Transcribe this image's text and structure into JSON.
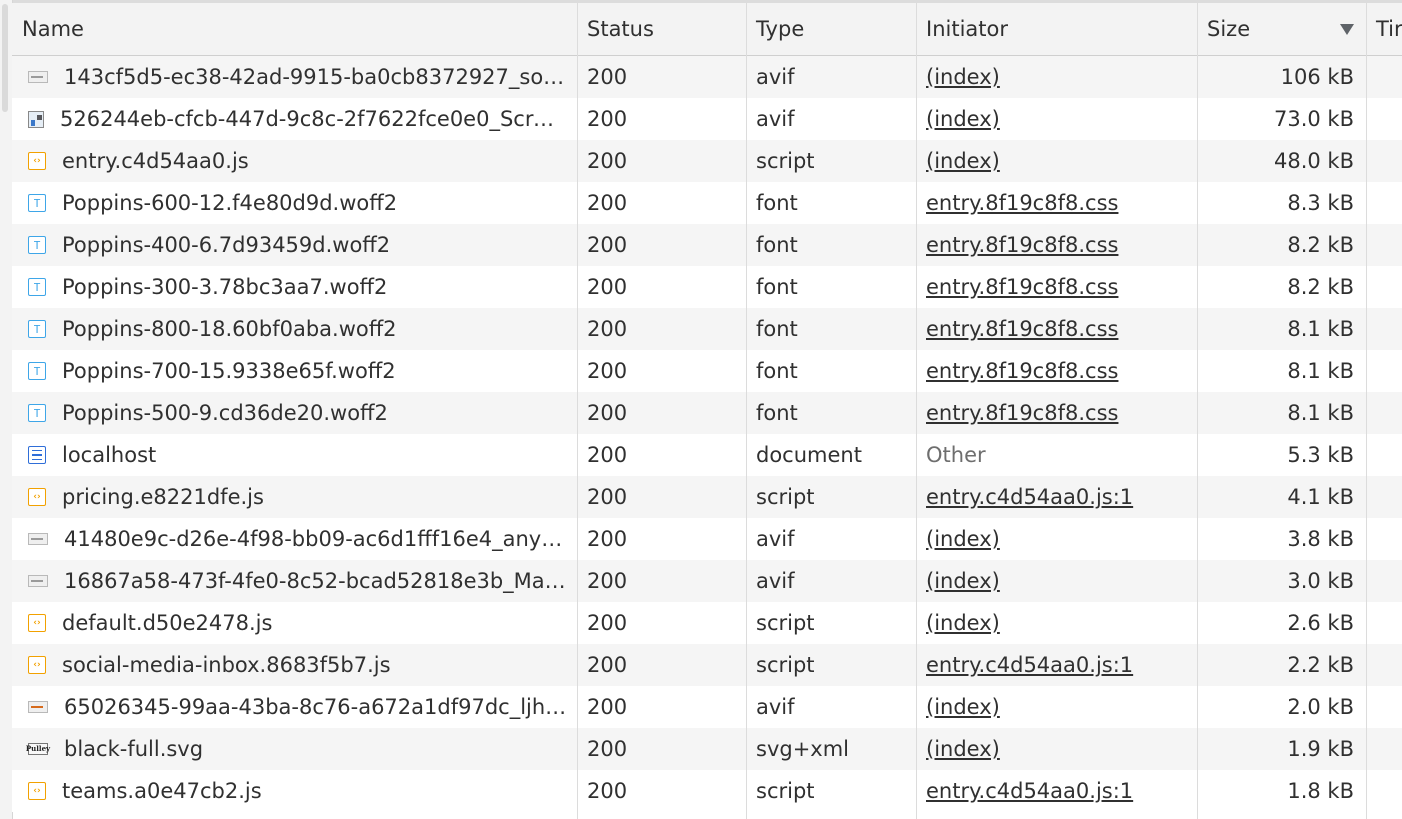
{
  "columns": {
    "name": "Name",
    "status": "Status",
    "type": "Type",
    "initiator": "Initiator",
    "size": "Size",
    "time": "Tir"
  },
  "rows": [
    {
      "icon": "image-thumbnail-icon",
      "name": "143cf5d5-ec38-42ad-9915-ba0cb8372927_so…",
      "status": "200",
      "type": "avif",
      "initiator": "(index)",
      "initiator_link": true,
      "size": "106 kB"
    },
    {
      "icon": "image-thumbnail-icon",
      "name": "526244eb-cfcb-447d-9c8c-2f7622fce0e0_Scre…",
      "status": "200",
      "type": "avif",
      "initiator": "(index)",
      "initiator_link": true,
      "size": "73.0 kB"
    },
    {
      "icon": "script-file-icon",
      "name": "entry.c4d54aa0.js",
      "status": "200",
      "type": "script",
      "initiator": "(index)",
      "initiator_link": true,
      "size": "48.0 kB"
    },
    {
      "icon": "font-file-icon",
      "name": "Poppins-600-12.f4e80d9d.woff2",
      "status": "200",
      "type": "font",
      "initiator": "entry.8f19c8f8.css",
      "initiator_link": true,
      "size": "8.3 kB"
    },
    {
      "icon": "font-file-icon",
      "name": "Poppins-400-6.7d93459d.woff2",
      "status": "200",
      "type": "font",
      "initiator": "entry.8f19c8f8.css",
      "initiator_link": true,
      "size": "8.2 kB"
    },
    {
      "icon": "font-file-icon",
      "name": "Poppins-300-3.78bc3aa7.woff2",
      "status": "200",
      "type": "font",
      "initiator": "entry.8f19c8f8.css",
      "initiator_link": true,
      "size": "8.2 kB"
    },
    {
      "icon": "font-file-icon",
      "name": "Poppins-800-18.60bf0aba.woff2",
      "status": "200",
      "type": "font",
      "initiator": "entry.8f19c8f8.css",
      "initiator_link": true,
      "size": "8.1 kB"
    },
    {
      "icon": "font-file-icon",
      "name": "Poppins-700-15.9338e65f.woff2",
      "status": "200",
      "type": "font",
      "initiator": "entry.8f19c8f8.css",
      "initiator_link": true,
      "size": "8.1 kB"
    },
    {
      "icon": "font-file-icon",
      "name": "Poppins-500-9.cd36de20.woff2",
      "status": "200",
      "type": "font",
      "initiator": "entry.8f19c8f8.css",
      "initiator_link": true,
      "size": "8.1 kB"
    },
    {
      "icon": "document-file-icon",
      "name": "localhost",
      "status": "200",
      "type": "document",
      "initiator": "Other",
      "initiator_link": false,
      "size": "5.3 kB"
    },
    {
      "icon": "script-file-icon",
      "name": "pricing.e8221dfe.js",
      "status": "200",
      "type": "script",
      "initiator": "entry.c4d54aa0.js:1",
      "initiator_link": true,
      "size": "4.1 kB"
    },
    {
      "icon": "image-thumbnail-icon",
      "name": "41480e9c-d26e-4f98-bb09-ac6d1fff16e4_anyt…",
      "status": "200",
      "type": "avif",
      "initiator": "(index)",
      "initiator_link": true,
      "size": "3.8 kB"
    },
    {
      "icon": "image-thumbnail-icon",
      "name": "16867a58-473f-4fe0-8c52-bcad52818e3b_Ma…",
      "status": "200",
      "type": "avif",
      "initiator": "(index)",
      "initiator_link": true,
      "size": "3.0 kB"
    },
    {
      "icon": "script-file-icon",
      "name": "default.d50e2478.js",
      "status": "200",
      "type": "script",
      "initiator": "(index)",
      "initiator_link": true,
      "size": "2.6 kB"
    },
    {
      "icon": "script-file-icon",
      "name": "social-media-inbox.8683f5b7.js",
      "status": "200",
      "type": "script",
      "initiator": "entry.c4d54aa0.js:1",
      "initiator_link": true,
      "size": "2.2 kB"
    },
    {
      "icon": "image-thumbnail-icon",
      "name": "65026345-99aa-43ba-8c76-a672a1df97dc_ljh…",
      "status": "200",
      "type": "avif",
      "initiator": "(index)",
      "initiator_link": true,
      "size": "2.0 kB"
    },
    {
      "icon": "svg-image-icon",
      "name": "black-full.svg",
      "status": "200",
      "type": "svg+xml",
      "initiator": "(index)",
      "initiator_link": true,
      "size": "1.9 kB"
    },
    {
      "icon": "script-file-icon",
      "name": "teams.a0e47cb2.js",
      "status": "200",
      "type": "script",
      "initiator": "entry.c4d54aa0.js:1",
      "initiator_link": true,
      "size": "1.8 kB"
    }
  ],
  "svg_icon_text": "Pulley",
  "colors": {
    "script_icon": "#f2a100",
    "font_icon": "#3ea6e8",
    "document_icon": "#2f6ed8",
    "header_bg": "#f3f3f3",
    "row_stripe": "#f5f5f5"
  }
}
